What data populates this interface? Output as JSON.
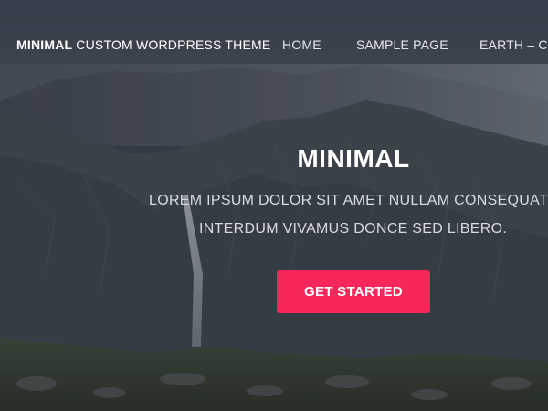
{
  "header": {
    "brand_bold": "MINIMAL",
    "brand_rest": "CUSTOM WORDPRESS THEME",
    "nav": [
      {
        "label": "HOME"
      },
      {
        "label": "SAMPLE PAGE"
      },
      {
        "label": "EARTH – CU"
      }
    ]
  },
  "hero": {
    "title": "MINIMAL",
    "subtitle_line1": "LOREM IPSUM DOLOR SIT AMET NULLAM CONSEQUAT",
    "subtitle_line2": "INTERDUM VIVAMUS DONCE SED LIBERO.",
    "cta_label": "GET STARTED",
    "background_image": "misty-mountain-waterfall-photo"
  },
  "colors": {
    "accent": "#f72859",
    "text_primary": "#ffffff",
    "text_secondary": "#d9dbe0",
    "overlay": "#2f3540"
  }
}
